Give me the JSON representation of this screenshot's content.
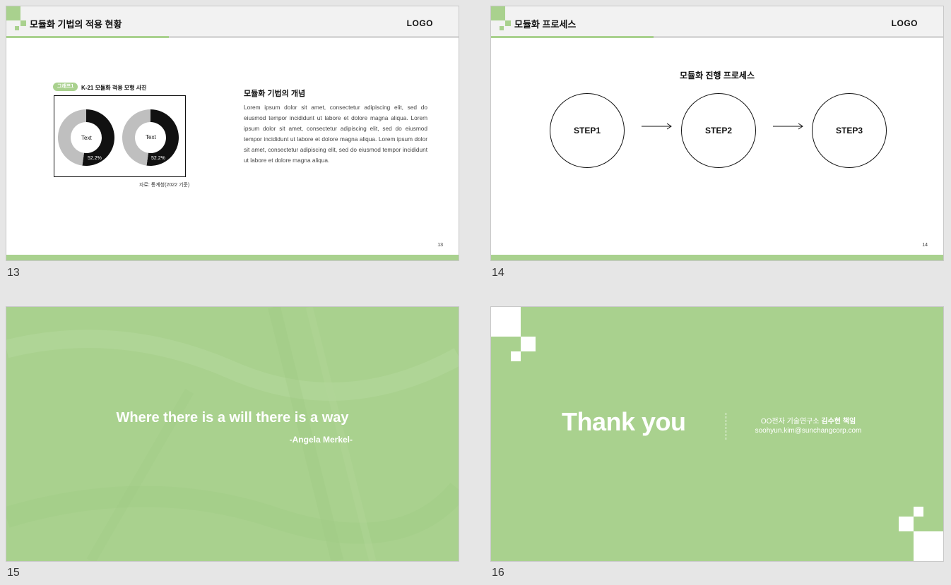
{
  "slides": [
    {
      "number": "13",
      "header": {
        "title": "모듈화 기법의 적용 현황",
        "logo": "LOGO"
      },
      "chart": {
        "chip": "그래프1",
        "title": "K-21 모듈화 적용 모형 사진",
        "source": "자료: 통계청(2022 기준)"
      },
      "concept": {
        "title": "모듈화 기법의 개념",
        "body": "Lorem ipsum dolor sit amet, consectetur adipiscing elit, sed do eiusmod tempor incididunt ut labore et dolore magna aliqua. Lorem ipsum dolor sit amet, consectetur adipiscing elit, sed do eiusmod tempor incididunt ut labore et dolore magna aliqua. Lorem ipsum dolor sit amet, consectetur adipiscing elit, sed do eiusmod tempor incididunt ut labore et dolore magna aliqua."
      },
      "page": "13"
    },
    {
      "number": "14",
      "header": {
        "title": "모듈화 프로세스",
        "logo": "LOGO"
      },
      "process": {
        "title": "모듈화 진행 프로세스",
        "steps": [
          "STEP1",
          "STEP2",
          "STEP3"
        ]
      },
      "page": "14"
    },
    {
      "number": "15",
      "quote": "Where there is a will there is a way",
      "author": "-Angela Merkel-"
    },
    {
      "number": "16",
      "thank_you": "Thank you",
      "contact": {
        "org": "OO전자 기술연구소",
        "person": "김수현 책임",
        "email": "soohyun.kim@sunchangcorp.com"
      }
    }
  ],
  "chart_data": {
    "type": "pie",
    "charts": [
      {
        "center_label": "Text",
        "value_label": "52.2%",
        "values": [
          52.2,
          47.8
        ]
      },
      {
        "center_label": "Text",
        "value_label": "52.2%",
        "values": [
          52.2,
          47.8
        ]
      }
    ]
  },
  "colors": {
    "accent": "#a9d18e",
    "header_bg": "#f2f2f2",
    "dark": "#111111",
    "light_gray": "#bfbfbf"
  }
}
